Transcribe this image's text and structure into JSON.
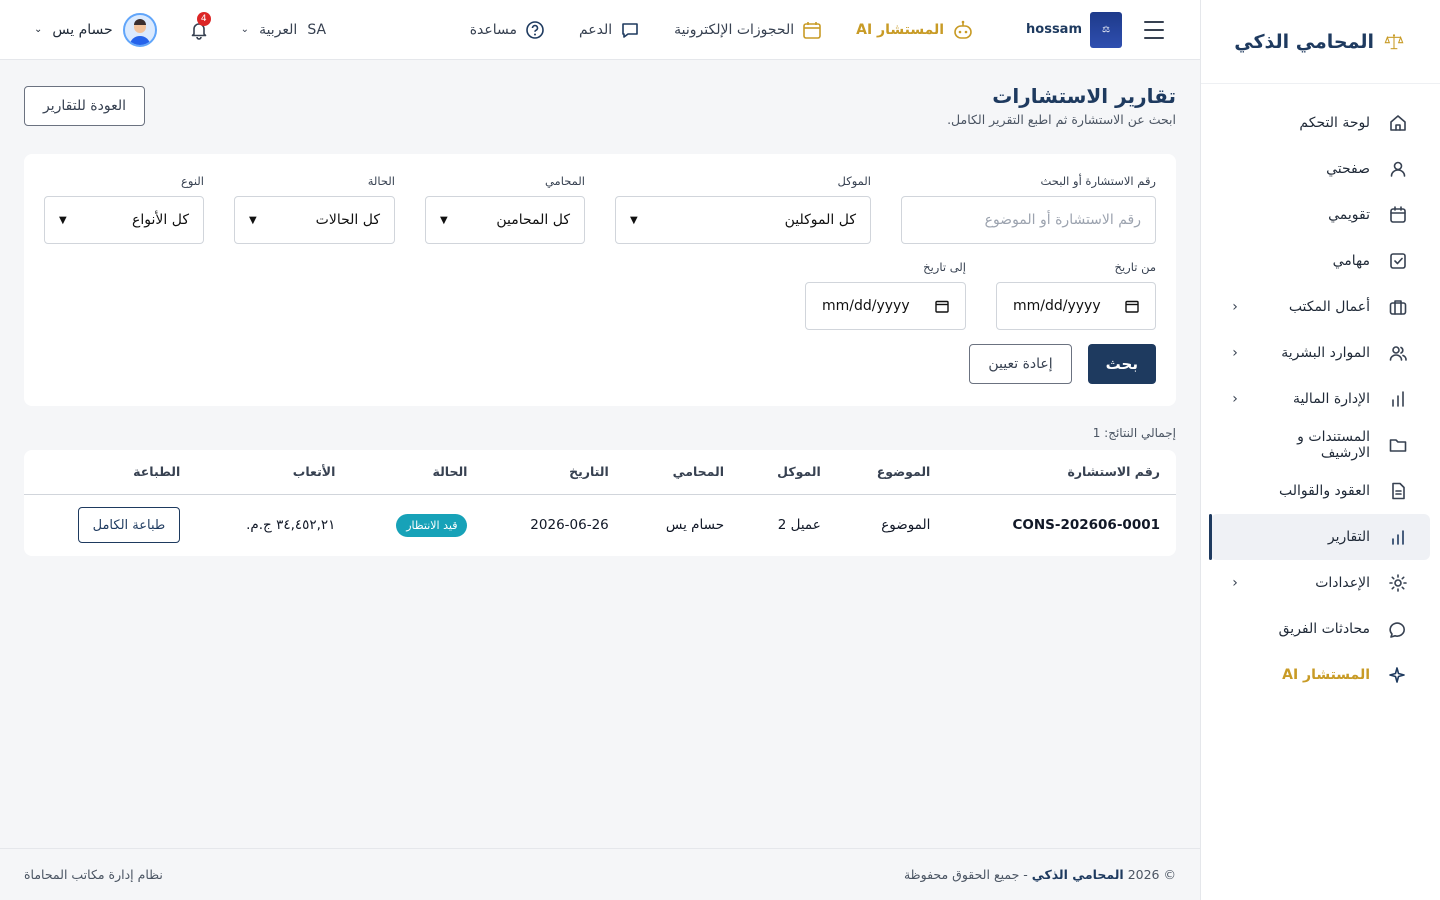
{
  "brand": {
    "title": "المحامي الذكي",
    "accent": "#1e3a5f",
    "gold": "#c89b26"
  },
  "sidebar": {
    "items": [
      {
        "label": "لوحة التحكم",
        "icon": "home-icon",
        "has_children": false,
        "active": false
      },
      {
        "label": "صفحتي",
        "icon": "user-icon",
        "has_children": false,
        "active": false
      },
      {
        "label": "تقويمي",
        "icon": "calendar-icon",
        "has_children": false,
        "active": false
      },
      {
        "label": "مهامي",
        "icon": "checkbox-icon",
        "has_children": false,
        "active": false
      },
      {
        "label": "أعمال المكتب",
        "icon": "briefcase-icon",
        "has_children": true,
        "active": false
      },
      {
        "label": "الموارد البشرية",
        "icon": "users-icon",
        "has_children": true,
        "active": false
      },
      {
        "label": "الإدارة المالية",
        "icon": "bar-chart-icon",
        "has_children": true,
        "active": false
      },
      {
        "label": "المستندات و الارشيف",
        "icon": "folder-icon",
        "has_children": false,
        "active": false
      },
      {
        "label": "العقود والقوالب",
        "icon": "document-icon",
        "has_children": false,
        "active": false
      },
      {
        "label": "التقارير",
        "icon": "chart-icon",
        "has_children": false,
        "active": true
      },
      {
        "label": "الإعدادات",
        "icon": "gear-icon",
        "has_children": true,
        "active": false
      },
      {
        "label": "محادثات الفريق",
        "icon": "chat-icon",
        "has_children": false,
        "active": false
      },
      {
        "label": "المستشار AI",
        "icon": "sparkle-icon",
        "has_children": false,
        "active": false
      }
    ]
  },
  "topbar": {
    "org_name": "hossam",
    "links": {
      "ai_advisor": "المستشار AI",
      "bookings": "الحجوزات الإلكترونية",
      "support": "الدعم",
      "help": "مساعدة"
    },
    "language": {
      "code": "SA",
      "label": "العربية"
    },
    "notifications_count": "4",
    "user_name": "حسام يس"
  },
  "page": {
    "title": "تقارير الاستشارات",
    "subtitle": "ابحث عن الاستشارة ثم اطبع التقرير الكامل.",
    "back_button": "العودة للتقارير"
  },
  "filters": {
    "search": {
      "label": "رقم الاستشارة أو البحث",
      "placeholder": "رقم الاستشارة أو الموضوع"
    },
    "client": {
      "label": "الموكل",
      "value": "كل الموكلين"
    },
    "lawyer": {
      "label": "المحامي",
      "value": "كل المحامين"
    },
    "status": {
      "label": "الحالة",
      "value": "كل الحالات"
    },
    "type": {
      "label": "النوع",
      "value": "كل الأنواع"
    },
    "from_date": {
      "label": "من تاريخ",
      "value": "mm/dd/yyyy"
    },
    "to_date": {
      "label": "إلى تاريخ",
      "value": "mm/dd/yyyy"
    },
    "search_button": "بحث",
    "reset_button": "إعادة تعيين"
  },
  "results": {
    "total_label": "إجمالي النتائج: 1",
    "columns": [
      "رقم الاستشارة",
      "الموضوع",
      "الموكل",
      "المحامي",
      "التاريخ",
      "الحالة",
      "الأتعاب",
      "الطباعة"
    ],
    "rows": [
      {
        "number": "CONS-202606-0001",
        "subject": "الموضوع",
        "client": "عميل 2",
        "lawyer": "حسام يس",
        "date": "2026-06-26",
        "status": "قيد الانتظار",
        "fees": "٣٤,٤٥٢,٢١ ج.م.",
        "print_label": "طباعة الكامل"
      }
    ]
  },
  "footer": {
    "copyright_prefix": "© 2026",
    "copyright_brand": "المحامي الذكي",
    "copyright_suffix": "- جميع الحقوق محفوظة",
    "system_name": "نظام إدارة مكاتب المحاماة"
  }
}
